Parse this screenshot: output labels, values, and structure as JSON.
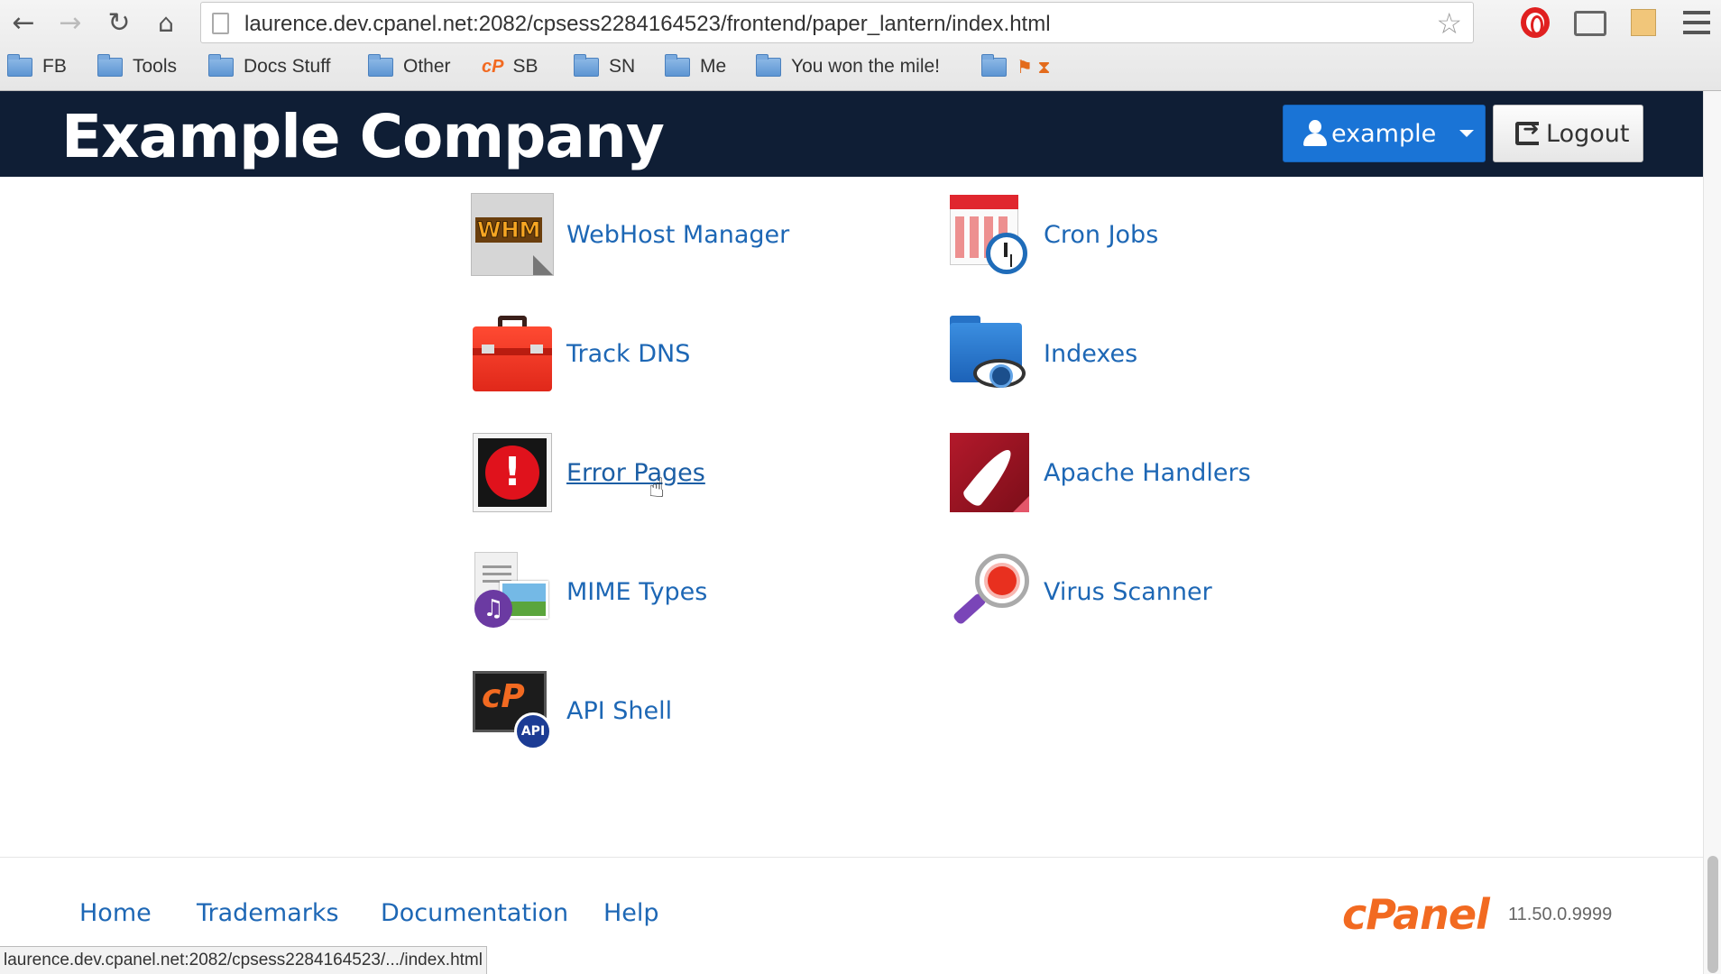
{
  "browser": {
    "url": "laurence.dev.cpanel.net:2082/cpsess2284164523/frontend/paper_lantern/index.html",
    "back_icon": "back-arrow-icon",
    "forward_icon": "forward-arrow-icon",
    "reload_icon": "reload-icon",
    "home_icon": "home-icon",
    "bookmarks": [
      {
        "label": "FB",
        "icon": "folder-icon"
      },
      {
        "label": "Tools",
        "icon": "folder-icon"
      },
      {
        "label": "Docs Stuff",
        "icon": "folder-icon"
      },
      {
        "label": "Other",
        "icon": "folder-icon"
      },
      {
        "label": "SB",
        "icon": "cpanel-icon"
      },
      {
        "label": "SN",
        "icon": "folder-icon"
      },
      {
        "label": "Me",
        "icon": "folder-icon"
      },
      {
        "label": "You won the mile!",
        "icon": "folder-icon"
      },
      {
        "label": "",
        "icon": "folder-icon"
      }
    ],
    "status_url": "laurence.dev.cpanel.net:2082/cpsess2284164523/.../index.html"
  },
  "header": {
    "company": "Example Company",
    "user_label": "example",
    "logout_label": "Logout",
    "background": "#0f1e35",
    "accent": "#1a74d6"
  },
  "features": {
    "left": [
      {
        "label": "WebHost Manager",
        "icon": "whm-icon"
      },
      {
        "label": "Track DNS",
        "icon": "toolbox-icon"
      },
      {
        "label": "Error Pages",
        "icon": "error-icon"
      },
      {
        "label": "MIME Types",
        "icon": "mime-icon"
      },
      {
        "label": "API Shell",
        "icon": "api-shell-icon"
      }
    ],
    "right": [
      {
        "label": "Cron Jobs",
        "icon": "calendar-clock-icon"
      },
      {
        "label": "Indexes",
        "icon": "folder-eye-icon"
      },
      {
        "label": "Apache Handlers",
        "icon": "feather-icon"
      },
      {
        "label": "Virus Scanner",
        "icon": "magnifier-bug-icon"
      }
    ],
    "whm_text": "WHM",
    "api_cp_text": "cP",
    "api_badge_text": "API",
    "link_color": "#1d67b5"
  },
  "footer": {
    "links": [
      "Home",
      "Trademarks",
      "Documentation",
      "Help"
    ],
    "logo": "cPanel",
    "version": "11.50.0.9999",
    "logo_color": "#f26a21"
  }
}
